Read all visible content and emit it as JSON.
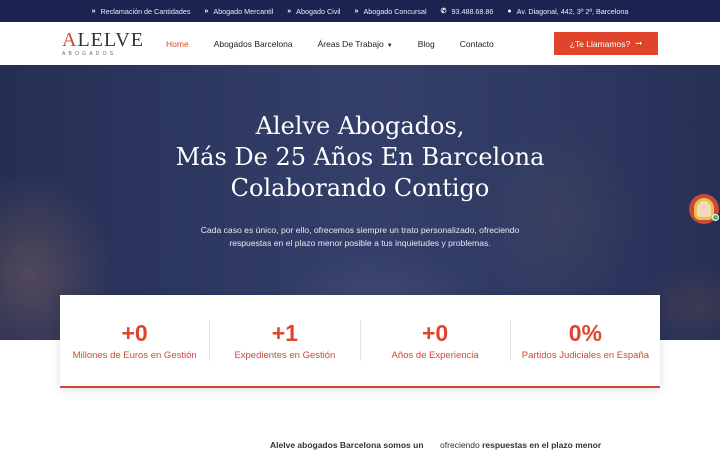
{
  "topbar": {
    "items": [
      {
        "icon": "chevrons-right-icon",
        "label": "Reclamación de Cantidades"
      },
      {
        "icon": "chevrons-right-icon",
        "label": "Abogado Mercantil"
      },
      {
        "icon": "chevrons-right-icon",
        "label": "Abogado Civil"
      },
      {
        "icon": "chevrons-right-icon",
        "label": "Abogado Concursal"
      },
      {
        "icon": "phone-icon",
        "label": "93.488.68.86"
      },
      {
        "icon": "map-pin-icon",
        "label": "Av. Diagonal, 442, 3º 2ª, Barcelona"
      }
    ]
  },
  "logo": {
    "name": "ALELVE",
    "subtitle": "ABOGADOS"
  },
  "nav": {
    "items": [
      {
        "label": "Home",
        "active": true
      },
      {
        "label": "Abogados Barcelona"
      },
      {
        "label": "Áreas De Trabajo",
        "has_caret": true
      },
      {
        "label": "Blog"
      },
      {
        "label": "Contacto"
      }
    ],
    "cta": "¿Te Llamamos?"
  },
  "hero": {
    "line1": "Alelve Abogados,",
    "line2": "Más De 25 Años En Barcelona",
    "line3": "Colaborando Contigo",
    "text": "Cada caso es único, por ello, ofrecemos siempre un trato personalizado, ofreciendo respuestas en el plazo menor posible a tus inquietudes y problemas."
  },
  "stats": [
    {
      "value": "+0",
      "label": "Millones de Euros en Gestión"
    },
    {
      "value": "+1",
      "label": "Expedientes en Gestión"
    },
    {
      "value": "+0",
      "label": "Años de Experiencia"
    },
    {
      "value": "0%",
      "label": "Partidos Judiciales en España"
    }
  ],
  "bottom": {
    "bold1": "Alelve  abogados  Barcelona  somos  un",
    "normal": "ofreciendo",
    "bold2": "respuestas en el plazo menor"
  },
  "colors": {
    "accent": "#e0442a",
    "topbar": "#1b2451"
  }
}
